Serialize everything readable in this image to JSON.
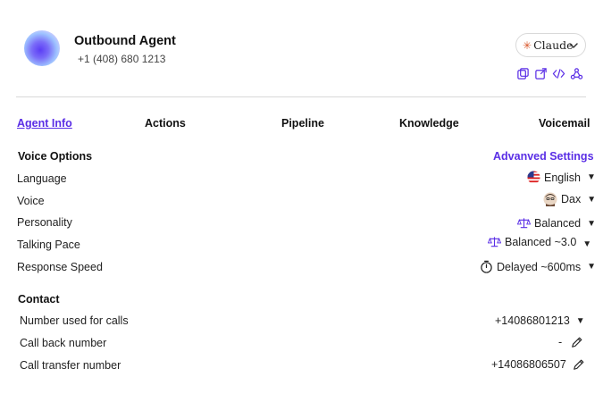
{
  "agent": {
    "name": "Outbound Agent",
    "phone": "+1 (408) 680 1213"
  },
  "model": {
    "label": "Claude"
  },
  "tools": [
    "copy-icon",
    "external-link-icon",
    "code-icon",
    "webhook-icon"
  ],
  "tabs": [
    {
      "label": "Agent Info",
      "active": true
    },
    {
      "label": "Actions"
    },
    {
      "label": "Pipeline"
    },
    {
      "label": "Knowledge"
    },
    {
      "label": "Voicemail"
    }
  ],
  "voice_options": {
    "title": "Voice Options",
    "advanced_label": "Advanved Settings",
    "language": {
      "label": "Language",
      "value": "English"
    },
    "voice": {
      "label": "Voice",
      "value": "Dax"
    },
    "personality": {
      "label": "Personality",
      "value": "Balanced"
    },
    "talking_pace": {
      "label": "Talking Pace",
      "value": "Balanced ~3.0"
    },
    "response_speed": {
      "label": "Response Speed",
      "value": "Delayed ~600ms"
    }
  },
  "contact": {
    "title": "Contact",
    "number_for_calls": {
      "label": "Number used for calls",
      "value": "+14086801213"
    },
    "callback_number": {
      "label": "Call back number",
      "value": "-"
    },
    "transfer_number": {
      "label": "Call transfer number",
      "value": "+14086806507"
    }
  },
  "colors": {
    "accent": "#5a2ee6",
    "divider": "#d8d8d8"
  }
}
